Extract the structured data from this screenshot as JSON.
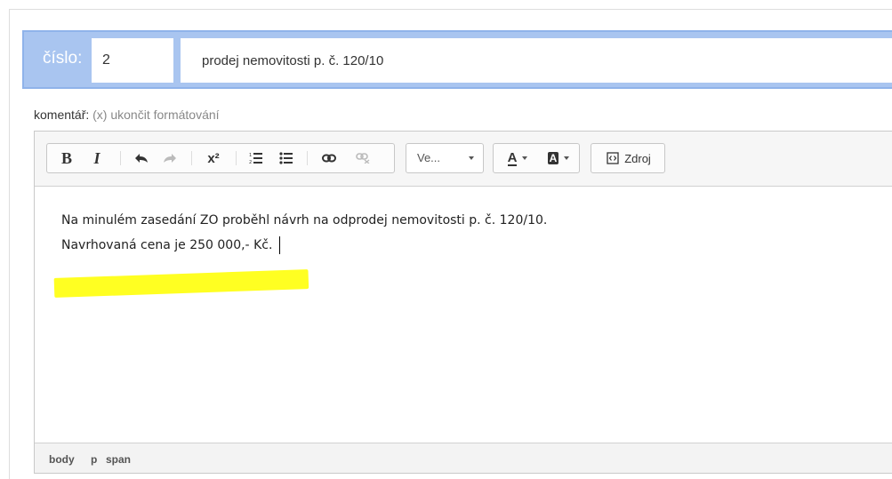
{
  "header": {
    "number_label": "číslo:",
    "number_value": "2",
    "title_value": "prodej nemovitosti p. č. 120/10"
  },
  "comment": {
    "label": "komentář:",
    "hint": "(x) ukončit formátování"
  },
  "toolbar": {
    "bold": "B",
    "italic": "I",
    "superscript": "x²",
    "format_combo": "Ve...",
    "text_color": "A",
    "bg_color": "A",
    "source_label": "Zdroj"
  },
  "editor": {
    "line1": "Na minulém zasedání ZO proběhl návrh na odprodej nemovitosti p. č. 120/10.",
    "line2": "Navrhovaná cena je 250 000,- Kč."
  },
  "statusbar": {
    "path": [
      "body",
      "p",
      "span"
    ]
  },
  "colors": {
    "header_bg": "#a9c5f0",
    "highlight": "#ffff22"
  }
}
